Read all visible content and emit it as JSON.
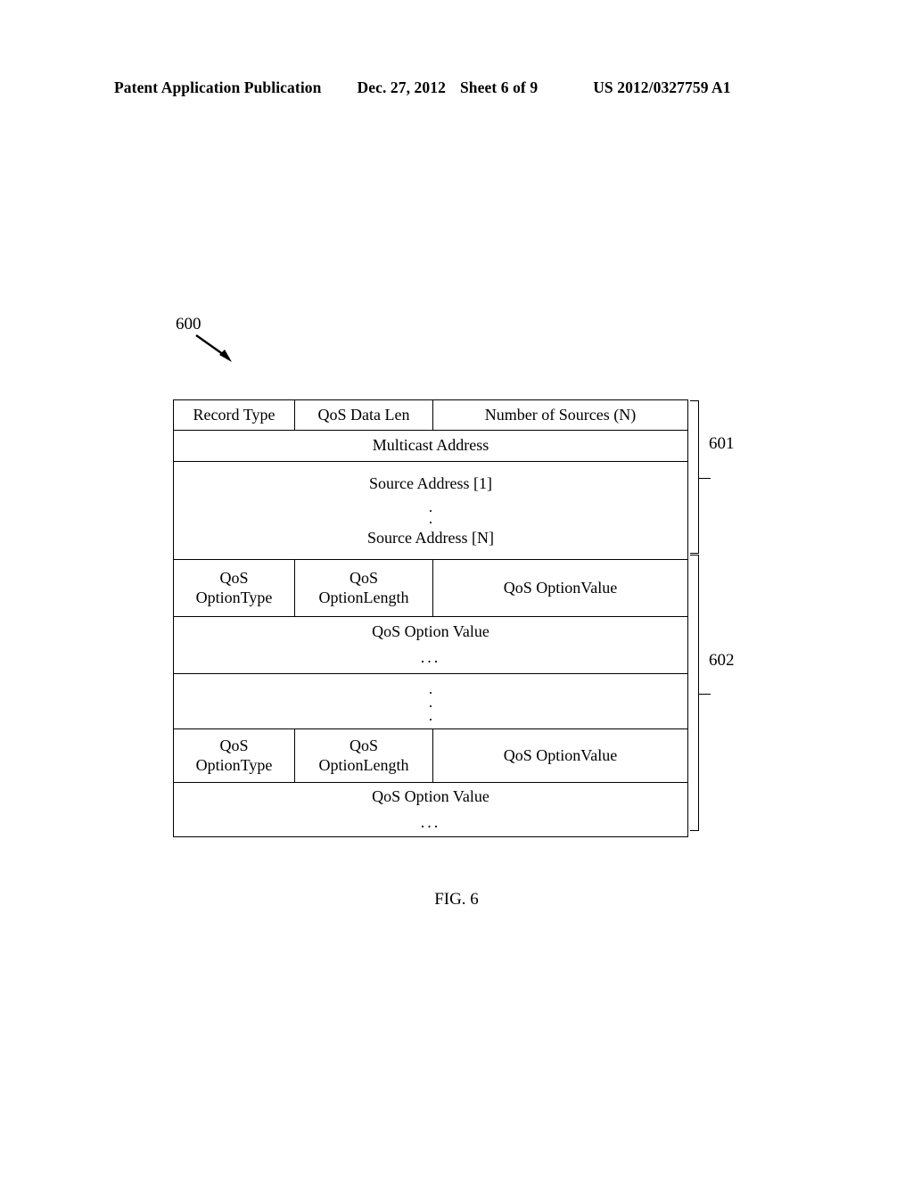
{
  "header": {
    "publication": "Patent Application Publication",
    "date": "Dec. 27, 2012",
    "sheet": "Sheet 6 of 9",
    "patent_number": "US 2012/0327759 A1"
  },
  "figure": {
    "reference_600": "600",
    "caption": "FIG. 6",
    "bracket_601": "601",
    "bracket_602": "602"
  },
  "packet": {
    "header_row": {
      "record_type": "Record Type",
      "qos_data_len": "QoS Data Len",
      "number_of_sources": "Number of Sources (N)"
    },
    "multicast_address": "Multicast Address",
    "source_block": {
      "first": "Source Address [1]",
      "last": "Source Address [N]",
      "dot": "."
    },
    "qos_option_row_1": {
      "option_type_line1": "QoS",
      "option_type_line2": "OptionType",
      "option_length_line1": "QoS",
      "option_length_line2": "OptionLength",
      "option_value": "QoS OptionValue"
    },
    "qos_value_row_1": {
      "label": "QoS Option Value",
      "ellipsis": "..."
    },
    "vertical_ellipsis": {
      "dot": "."
    },
    "qos_option_row_2": {
      "option_type_line1": "QoS",
      "option_type_line2": "OptionType",
      "option_length_line1": "QoS",
      "option_length_line2": "OptionLength",
      "option_value": "QoS OptionValue"
    },
    "qos_value_row_2": {
      "label": "QoS Option Value",
      "ellipsis": "..."
    }
  }
}
